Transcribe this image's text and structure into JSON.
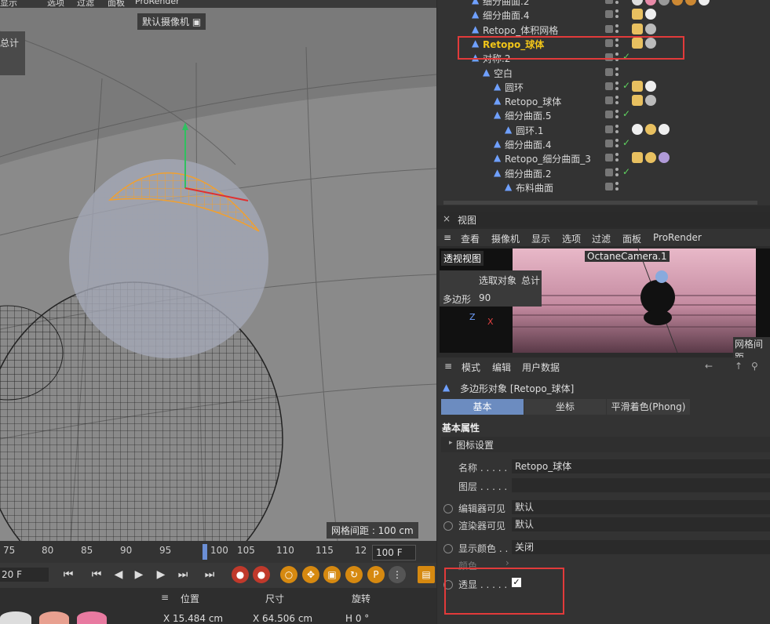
{
  "top_menu": [
    "显示",
    "选项",
    "过滤",
    "面板",
    "ProRender"
  ],
  "viewport": {
    "camera_label": "默认摄像机",
    "info_label": "总计",
    "grid_spacing": "网格间距 : 100 cm"
  },
  "timeline": {
    "ticks": [
      "75",
      "80",
      "85",
      "90",
      "95",
      "100",
      "105",
      "110",
      "115",
      "12"
    ],
    "current_frame": "100 F",
    "start_field": "20 F"
  },
  "coords": {
    "pos_header": "位置",
    "size_header": "尺寸",
    "rot_header": "旋转",
    "pos_x": "X  15.484 cm",
    "size_x": "X  64.506 cm",
    "rot_h": "H  0 °"
  },
  "object_manager": {
    "rows": [
      {
        "name": "细分曲面.2",
        "indent": 0,
        "color": "#d8d8d8"
      },
      {
        "name": "细分曲面.4",
        "indent": 0,
        "color": "#d8d8d8"
      },
      {
        "name": "Retopo_体积网格",
        "indent": 0,
        "color": "#d8d8d8"
      },
      {
        "name": "Retopo_球体",
        "indent": 0,
        "color": "#f0c419"
      },
      {
        "name": "对称.2",
        "indent": 0,
        "color": "#d8d8d8"
      },
      {
        "name": "空白",
        "indent": 1,
        "color": "#d8d8d8"
      },
      {
        "name": "圆环",
        "indent": 2,
        "color": "#d8d8d8"
      },
      {
        "name": "Retopo_球体",
        "indent": 2,
        "color": "#d8d8d8"
      },
      {
        "name": "细分曲面.5",
        "indent": 2,
        "color": "#d8d8d8"
      },
      {
        "name": "圆环.1",
        "indent": 3,
        "color": "#d8d8d8"
      },
      {
        "name": "细分曲面.4",
        "indent": 2,
        "color": "#d8d8d8"
      },
      {
        "name": "Retopo_细分曲面_3",
        "indent": 2,
        "color": "#d8d8d8"
      },
      {
        "name": "细分曲面.2",
        "indent": 2,
        "color": "#d8d8d8"
      },
      {
        "name": "布料曲面",
        "indent": 3,
        "color": "#d8d8d8"
      }
    ]
  },
  "view_panel": {
    "title": "视图",
    "menu": [
      "查看",
      "摄像机",
      "显示",
      "选项",
      "过滤",
      "面板",
      "ProRender"
    ],
    "mini_label": "透视视图",
    "camera": "OctaneCamera.1",
    "info_select": "选取对象",
    "info_total": "总计",
    "info_poly": "多边形",
    "info_count": "90",
    "grid_short": "网格间距"
  },
  "attributes": {
    "menu": [
      "模式",
      "编辑",
      "用户数据"
    ],
    "object_title": "多边形对象 [Retopo_球体]",
    "tabs": [
      "基本",
      "坐标",
      "平滑着色(Phong)"
    ],
    "section": "基本属性",
    "subsection": "图标设置",
    "name_label": "名称 . . . . .",
    "name_value": "Retopo_球体",
    "layer_label": "图层 . . . . .",
    "editor_vis_label": "编辑器可见",
    "editor_vis_value": "默认",
    "render_vis_label": "渲染器可见",
    "render_vis_value": "默认",
    "display_color_label": "显示颜色 . .",
    "display_color_value": "关闭",
    "color_label": "颜色",
    "xray_label": "透显 . . . . .",
    "xray_checked": "✓"
  }
}
